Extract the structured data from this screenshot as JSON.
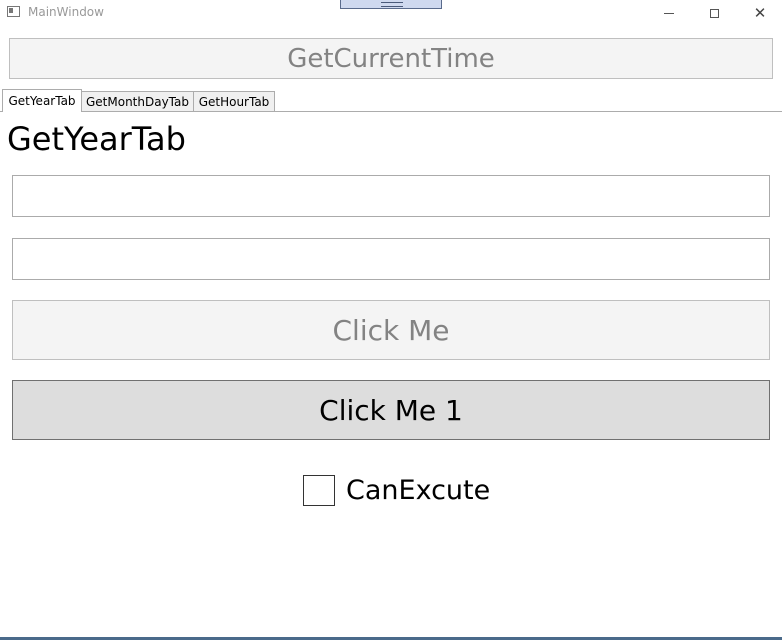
{
  "window": {
    "title": "MainWindow",
    "controls": {
      "minimize": "minimize-icon",
      "maximize": "maximize-icon",
      "close": "close-icon"
    },
    "close_glyph": "✕"
  },
  "toolbar": {
    "get_current_time_label": "GetCurrentTime"
  },
  "tabs": [
    {
      "label": "GetYearTab",
      "active": true
    },
    {
      "label": "GetMonthDayTab",
      "active": false
    },
    {
      "label": "GetHourTab",
      "active": false
    }
  ],
  "content": {
    "heading": "GetYearTab",
    "textbox1_value": "",
    "textbox2_value": "",
    "click_me_label": "Click Me",
    "click_me_enabled": false,
    "click_me_1_label": "Click Me 1",
    "click_me_1_enabled": true,
    "checkbox_label": "CanExcute",
    "checkbox_checked": false
  },
  "colors": {
    "disabled_button_bg": "#f4f4f4",
    "disabled_text": "#838383",
    "enabled_button_bg": "#dddddd",
    "dock_tab": "#cfd9ef"
  }
}
